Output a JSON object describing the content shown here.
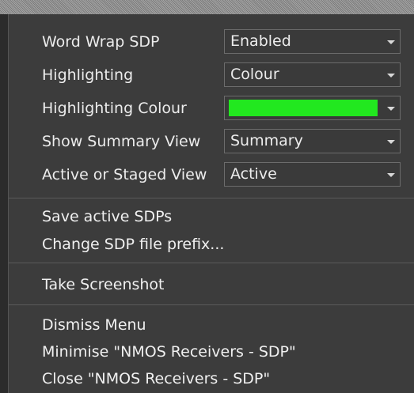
{
  "settings": [
    {
      "label": "Word Wrap SDP",
      "value": "Enabled"
    },
    {
      "label": "Highlighting",
      "value": "Colour"
    },
    {
      "label": "Highlighting Colour",
      "swatch": "#22e81f"
    },
    {
      "label": "Show Summary View",
      "value": "Summary"
    },
    {
      "label": "Active or Staged View",
      "value": "Active"
    }
  ],
  "sections": {
    "save_active": "Save active SDPs",
    "change_prefix": "Change SDP file prefix...",
    "take_screenshot": "Take Screenshot",
    "dismiss": "Dismiss Menu",
    "minimise": "Minimise \"NMOS Receivers - SDP\"",
    "close": "Close \"NMOS Receivers - SDP\""
  },
  "colors": {
    "menu_background": "#3c3c3c",
    "text": "#ececec",
    "highlight_swatch": "#22e81f"
  }
}
